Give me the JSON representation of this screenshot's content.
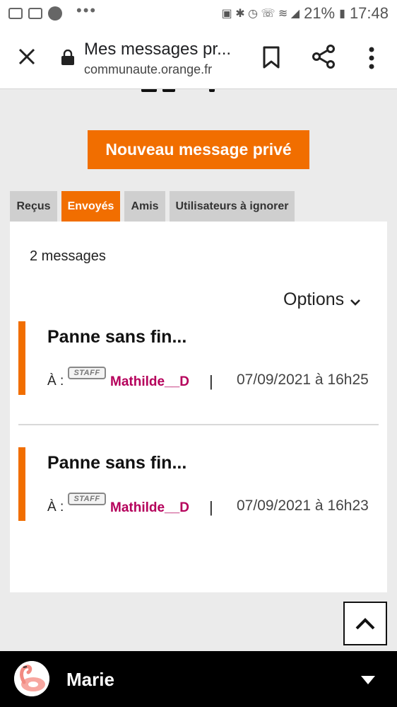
{
  "status_bar": {
    "battery": "21%",
    "time": "17:48"
  },
  "browser": {
    "title": "Mes messages pr...",
    "url": "communaute.orange.fr",
    "icons": [
      "close-icon",
      "lock-icon",
      "bookmark-icon",
      "share-icon",
      "more-vert-icon"
    ]
  },
  "page": {
    "new_message_label": "Nouveau message privé",
    "tabs": [
      {
        "label": "Reçus",
        "active": false
      },
      {
        "label": "Envoyés",
        "active": true
      },
      {
        "label": "Amis",
        "active": false
      },
      {
        "label": "Utilisateurs à ignorer",
        "active": false
      }
    ],
    "message_count": "2 messages",
    "options_label": "Options",
    "messages": [
      {
        "subject": "Panne sans fin...",
        "to_label": "À :",
        "badge": "STAFF",
        "recipient": "Mathilde__D",
        "separator": "|",
        "date": "07/09/2021 à 16h25"
      },
      {
        "subject": "Panne sans fin...",
        "to_label": "À :",
        "badge": "STAFF",
        "recipient": "Mathilde__D",
        "separator": "|",
        "date": "07/09/2021 à 16h23"
      }
    ]
  },
  "account_bar": {
    "username": "Marie"
  },
  "colors": {
    "accent": "#f16e00",
    "username": "#b5005b",
    "tab_inactive": "#cfcfcf",
    "background": "#ebebeb"
  }
}
